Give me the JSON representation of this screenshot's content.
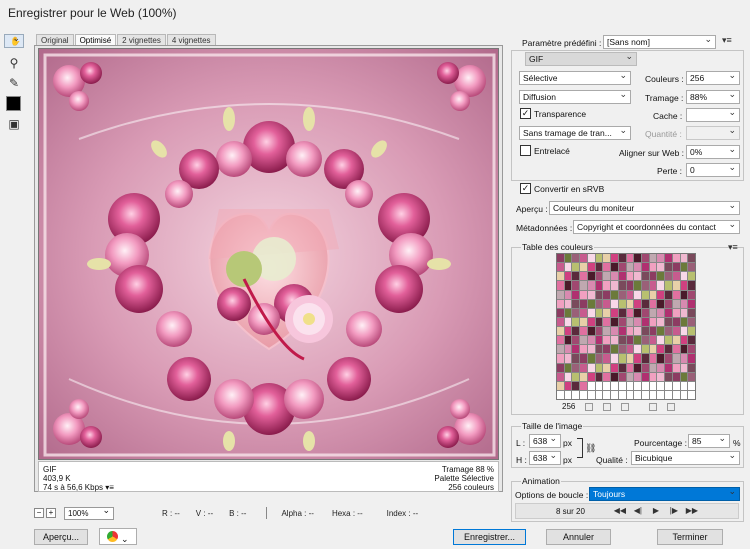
{
  "window": {
    "title": "Enregistrer pour le Web (100%)"
  },
  "tools": [
    "hand-icon",
    "slice-select-icon",
    "zoom-icon",
    "eyedropper-icon",
    "eyedropper-color-swatch",
    "toggle-slices-icon"
  ],
  "tabs": [
    "Original",
    "Optimisé",
    "2 vignettes",
    "4 vignettes"
  ],
  "preview_info": {
    "format": "GIF",
    "size": "403,9 K",
    "time": "74 s à 56,6 Kbps",
    "dither": "Tramage 88 %",
    "palette": "Palette Sélective",
    "colors": "256 couleurs"
  },
  "statusbar": {
    "zoom": "100%",
    "r": "R : --",
    "g": "V : --",
    "b": "B : --",
    "alpha": "Alpha : --",
    "hex": "Hexa : --",
    "index": "Index : --"
  },
  "buttons": {
    "preview": "Aperçu...",
    "save": "Enregistrer...",
    "cancel": "Annuler",
    "done": "Terminer"
  },
  "settings": {
    "preset_label": "Paramètre prédéfini :",
    "preset_value": "[Sans nom]",
    "format": "GIF",
    "palette": "Sélective",
    "dither_algo": "Diffusion",
    "transparency_label": "Transparence",
    "transparency_checked": true,
    "matte_dither": "Sans tramage de tran...",
    "interlaced_label": "Entrelacé",
    "interlaced_checked": false,
    "colors_label": "Couleurs :",
    "colors_value": "256",
    "dither_label": "Tramage :",
    "dither_value": "88%",
    "matte_label": "Cache :",
    "matte_value": "",
    "amount_label": "Quantité :",
    "amount_value": "",
    "web_snap_label": "Aligner sur Web :",
    "web_snap_value": "0%",
    "lossy_label": "Perte :",
    "lossy_value": "0",
    "srgb_label": "Convertir en sRVB",
    "srgb_checked": true,
    "preview_label": "Aperçu :",
    "preview_value": "Couleurs du moniteur",
    "metadata_label": "Métadonnées :",
    "metadata_value": "Copyright et coordonnées du contact"
  },
  "color_table": {
    "title": "Table des couleurs",
    "count": "256"
  },
  "image_size": {
    "title": "Taille de l'image",
    "w_label": "L :",
    "w_value": "638",
    "h_label": "H :",
    "h_value": "638",
    "unit": "px",
    "percent_label": "Pourcentage :",
    "percent_value": "85",
    "percent_unit": "%",
    "quality_label": "Qualité :",
    "quality_value": "Bicubique"
  },
  "animation": {
    "title": "Animation",
    "loop_label": "Options de boucle :",
    "loop_value": "Toujours",
    "frame": "8 sur 20"
  },
  "palette_colors": [
    "#8c3c62",
    "#d88ab0",
    "#5a2a3c",
    "#c75b8e",
    "#f0b8d0",
    "#a04870",
    "#e8d0a8",
    "#6b7a3a",
    "#b03070",
    "#e070a0",
    "#f8d8e8",
    "#7a4a5c",
    "#c0a8b0",
    "#d04080",
    "#9a6078",
    "#f0a0c0",
    "#4a1a2a",
    "#b8c070"
  ]
}
